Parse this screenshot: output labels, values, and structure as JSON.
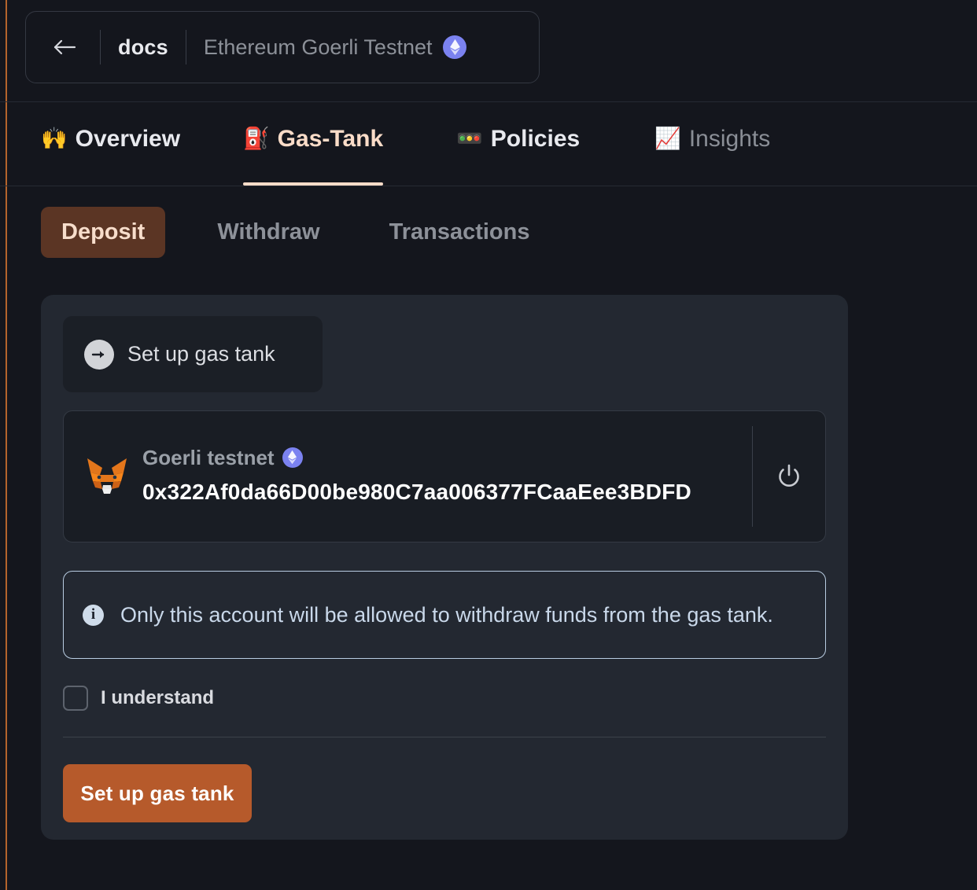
{
  "header": {
    "back_icon": "arrow-left-icon",
    "app_name": "docs",
    "network_name": "Ethereum Goerli Testnet",
    "network_badge_icon": "ethereum-icon"
  },
  "tabs": [
    {
      "emoji": "🙌",
      "icon_name": "raising-hands-icon",
      "label": "Overview",
      "active": false
    },
    {
      "emoji": "⛽",
      "icon_name": "fuel-pump-icon",
      "label": "Gas-Tank",
      "active": true
    },
    {
      "emoji": "🚥",
      "icon_name": "traffic-light-icon",
      "label": "Policies",
      "active": false
    },
    {
      "emoji": "📈",
      "icon_name": "chart-increasing-icon",
      "label": "Insights",
      "active": false
    }
  ],
  "subtabs": [
    {
      "label": "Deposit",
      "active": true
    },
    {
      "label": "Withdraw",
      "active": false
    },
    {
      "label": "Transactions",
      "active": false
    }
  ],
  "card": {
    "setup_panel": {
      "icon_name": "arrow-right-circle-icon",
      "label": "Set up gas tank"
    },
    "account": {
      "wallet_icon": "metamask-fox-icon",
      "network_label": "Goerli testnet",
      "network_badge_icon": "ethereum-icon",
      "address": "0x322Af0da66D00be980C7aa006377FCaaEee3BDFD",
      "disconnect_icon": "power-icon"
    },
    "callout": {
      "icon_name": "info-icon",
      "text": "Only this account will be allowed to withdraw funds from the gas tank."
    },
    "consent": {
      "checked": false,
      "label": "I understand"
    },
    "submit_label": "Set up gas tank"
  },
  "colors": {
    "background": "#14161d",
    "card": "#232831",
    "accent_orange": "#b65a2b",
    "active_tab_peach": "#fadcc8",
    "subtab_active_bg": "#5b3524",
    "callout_border": "#b9cde2",
    "ethereum_blue": "#7b82f0"
  }
}
